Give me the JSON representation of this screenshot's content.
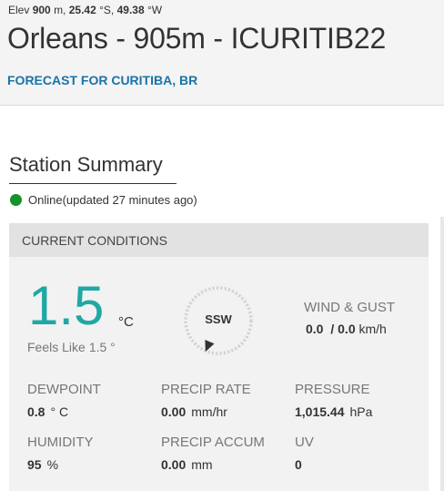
{
  "header": {
    "elev_label": "Elev",
    "elev_value": "900",
    "elev_unit": "m,",
    "lat_value": "25.42",
    "lat_unit": "°S,",
    "lon_value": "49.38",
    "lon_unit": "°W",
    "station_title": "Orleans - 905m - ICURITIB22",
    "forecast_link": "FORECAST FOR CURITIBA, BR"
  },
  "summary": {
    "title": "Station Summary",
    "status_text": "Online(updated 27 minutes ago)",
    "status_color": "#14922a"
  },
  "conditions": {
    "header": "CURRENT CONDITIONS",
    "temperature": "1.5",
    "temperature_unit": "°C",
    "feels_like_label": "Feels Like",
    "feels_like_value": "1.5 °",
    "wind_direction": "SSW",
    "wind_direction_degrees": 202.5,
    "wind_label": "WIND & GUST",
    "wind_speed": "0.0",
    "wind_separator": "/",
    "wind_gust": "0.0",
    "wind_unit": "km/h",
    "dewpoint_label": "DEWPOINT",
    "dewpoint_value": "0.8",
    "dewpoint_unit": "° C",
    "precip_rate_label": "PRECIP RATE",
    "precip_rate_value": "0.00",
    "precip_rate_unit": "mm/hr",
    "pressure_label": "PRESSURE",
    "pressure_value": "1,015.44",
    "pressure_unit": "hPa",
    "humidity_label": "HUMIDITY",
    "humidity_value": "95",
    "humidity_unit": "%",
    "precip_accum_label": "PRECIP ACCUM",
    "precip_accum_value": "0.00",
    "precip_accum_unit": "mm",
    "uv_label": "UV",
    "uv_value": "0"
  },
  "colors": {
    "temperature": "#20a8a5",
    "link": "#1a73a8",
    "online": "#14922a"
  }
}
